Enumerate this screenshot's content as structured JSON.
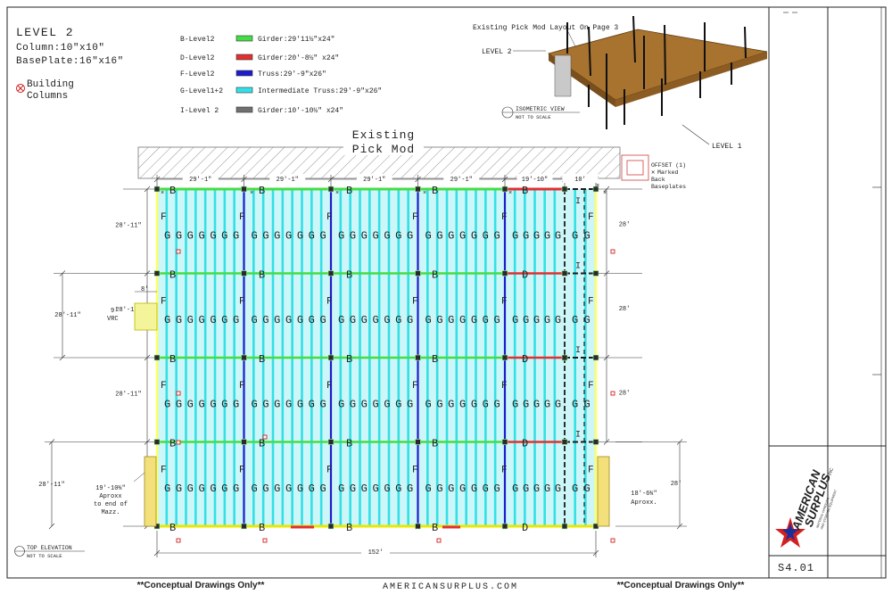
{
  "title": {
    "level": "LEVEL 2",
    "column": "Column:10\"x10\"",
    "baseplate": "BasePlate:16\"x16\"",
    "building_columns": [
      "Building",
      "Columns"
    ]
  },
  "legend": [
    {
      "code": "B-Level2",
      "label": "Girder:29'11½\"x24\"",
      "color": "#44dd44"
    },
    {
      "code": "D-Level2",
      "label": "Girder:20'-8½\" x24\"",
      "color": "#e03030"
    },
    {
      "code": "F-Level2",
      "label": "Truss:29'-9\"x26\"",
      "color": "#1c1ccc"
    },
    {
      "code": "G-Level1+2",
      "label": "Intermediate Truss:29'-9\"x26\"",
      "color": "#33e0e6"
    },
    {
      "code": "I-Level 2",
      "label": "Girder:10'-10½\" x24\"",
      "color": "#707070"
    }
  ],
  "existing": [
    "Existing",
    "Pick Mod"
  ],
  "iso": {
    "note": "Existing Pick Mod Layout On Page 3",
    "level2": "LEVEL 2",
    "level1": "LEVEL 1",
    "view_title": "ISOMETRIC VIEW",
    "view_scale": "NOT TO SCALE"
  },
  "offset_note": [
    "OFFSET (1)",
    "Marked",
    "Back",
    "Baseplates"
  ],
  "dims_top": [
    "29'-1\"",
    "29'-1\"",
    "29'-1\"",
    "29'-1\"",
    "19'-10\"",
    "10'"
  ],
  "dims_left": [
    "28'-11\"",
    "28'-11\"",
    "28'-11\"",
    "28'-11\""
  ],
  "dims_left_outer": [
    "28'-11\"",
    "28'-11\""
  ],
  "dims_right": [
    "28'",
    "28'",
    "28'"
  ],
  "dims_right_outer": "28'",
  "bottom_dim": "152'",
  "vrc": {
    "width": "8'",
    "label": [
      "9'",
      "VRC"
    ]
  },
  "left_note": [
    "19'-10¾\"",
    "Aproxx",
    "to end of",
    "Mazz."
  ],
  "right_note": [
    "18'-6¾\"",
    "Aproxx."
  ],
  "top_elevation": {
    "title": "TOP ELEVATION",
    "scale": "NOT TO SCALE"
  },
  "labels": {
    "b": "B",
    "d": "D",
    "f": "F",
    "i": "I",
    "g": "G"
  },
  "logo": {
    "line1": "AMERICAN",
    "line2": "SURPLUS",
    "inc": "INC",
    "tagline": [
      "MATERIAL HANDLING",
      "AND STORAGE EQUIPMENT"
    ]
  },
  "sheet_number": "S4.01",
  "footer": {
    "left": "**Conceptual Drawings Only**",
    "center": "AMERICANSURPLUS.COM",
    "right": "**Conceptual Drawings Only**"
  }
}
